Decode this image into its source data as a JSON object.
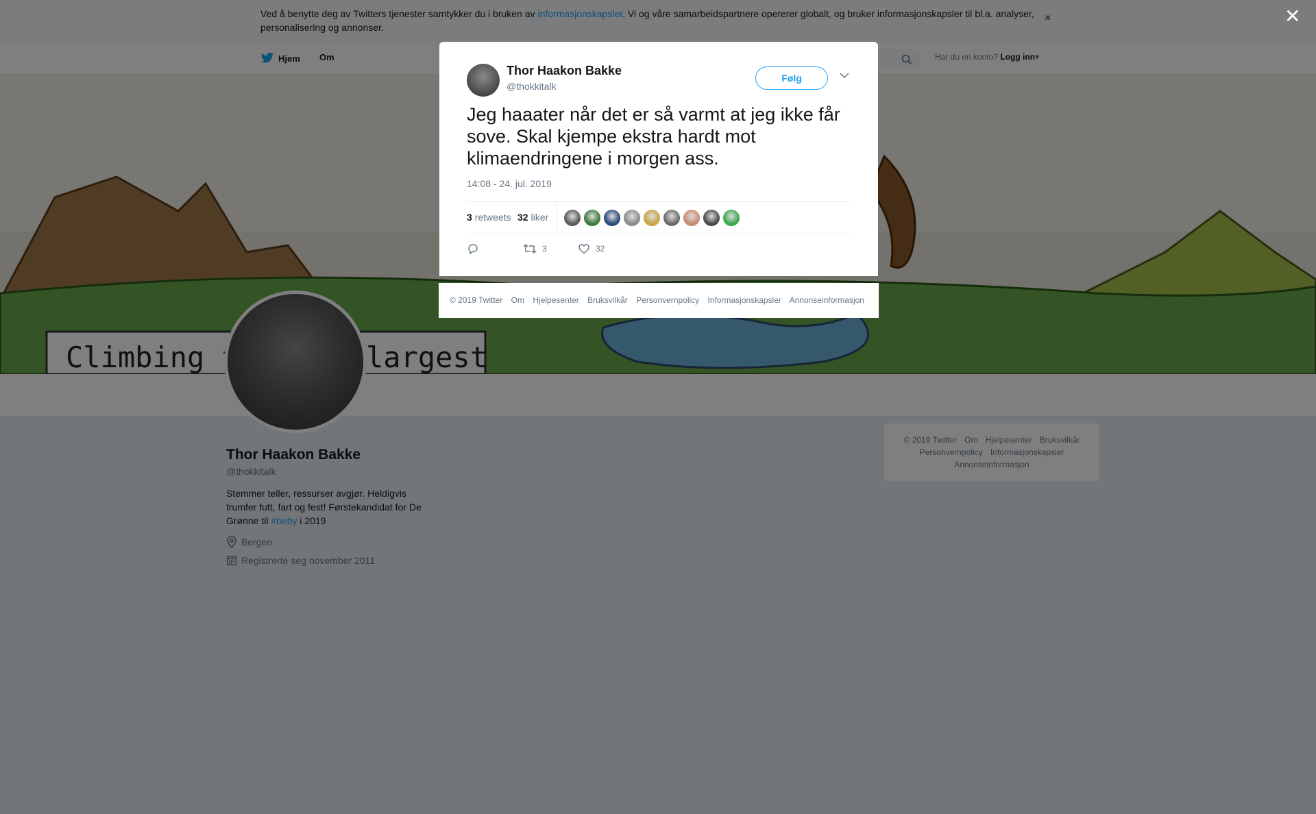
{
  "cookie": {
    "text_before": "Ved å benytte deg av Twitters tjenester samtykker du i bruken av ",
    "link": "informasjonskapsler",
    "text_after": ". Vi og våre samarbeidspartnere opererer globalt, og bruker informasjonskapsler til bl.a. analyser, personalisering og annonser.",
    "close": "×"
  },
  "nav": {
    "home": "Hjem",
    "about": "Om",
    "account_prompt": "Har du en konto?",
    "login": "Logg inn"
  },
  "banner": {
    "caption_left": "Climbing th",
    "caption_right": "largest"
  },
  "profile": {
    "name": "Thor Haakon Bakke",
    "handle": "@thokkitalk",
    "bio_before": "Stemmer teller, ressurser avgjør. Heldigvis trumfer futt, fart og fest! Førstekandidat for De Grønne til ",
    "bio_link": "#beby",
    "bio_after": " i 2019",
    "location": "Bergen",
    "joined": "Registrerte seg november 2011"
  },
  "side_footer": {
    "items": [
      "© 2019 Twitter",
      "Om",
      "Hjelpesenter",
      "Bruksvilkår",
      "Personvernpolicy",
      "Informasjonskapsler",
      "Annonseinformasjon"
    ]
  },
  "overlay": {
    "close": "✕"
  },
  "tweet": {
    "author_name": "Thor Haakon Bakke",
    "author_handle": "@thokkitalk",
    "follow_label": "Følg",
    "text": "Jeg haaater når det er så varmt at jeg ikke får sove. Skal kjempe ekstra hardt mot klimaendringene i morgen ass.",
    "timestamp": "14:08 - 24. jul. 2019",
    "retweets_count": "3",
    "retweets_label": "retweets",
    "likes_count": "32",
    "likes_label": "liker",
    "likers_colors": [
      "#5a5a5a",
      "#3c7a3c",
      "#2b4a7a",
      "#8a8a8a",
      "#c9a440",
      "#6a6a6a",
      "#c98a70",
      "#4a4a4a",
      "#3aa84a"
    ],
    "action_retweet_count": "3",
    "action_like_count": "32"
  },
  "modal_footer": {
    "items": [
      "© 2019 Twitter",
      "Om",
      "Hjelpesenter",
      "Bruksvilkår",
      "Personvernpolicy",
      "Informasjonskapsler",
      "Annonseinformasjon"
    ]
  },
  "colors": {
    "accent": "#1da1f2",
    "overlay": "rgba(0,0,0,0.5)"
  }
}
